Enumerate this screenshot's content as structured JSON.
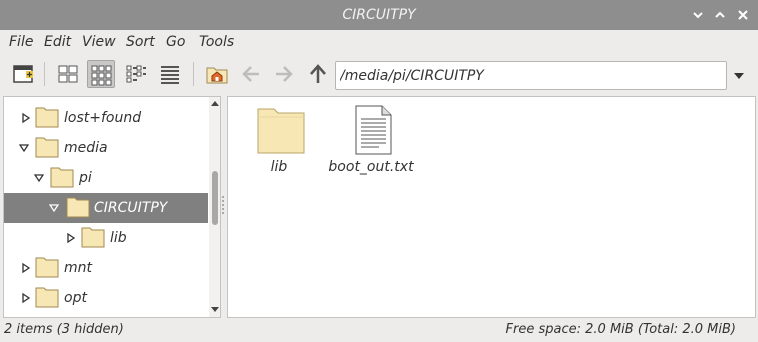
{
  "window": {
    "title": "CIRCUITPY"
  },
  "menubar": {
    "items": [
      "File",
      "Edit",
      "View",
      "Sort",
      "Go",
      "Tools"
    ]
  },
  "toolbar": {
    "path_value": "/media/pi/CIRCUITPY",
    "active_view": "icon-view"
  },
  "tree": {
    "items": [
      {
        "label": "lost+found",
        "expanded": false,
        "depth": 0
      },
      {
        "label": "media",
        "expanded": true,
        "depth": 0
      },
      {
        "label": "pi",
        "expanded": true,
        "depth": 1
      },
      {
        "label": "CIRCUITPY",
        "expanded": true,
        "depth": 2,
        "selected": true
      },
      {
        "label": "lib",
        "expanded": false,
        "depth": 3
      },
      {
        "label": "mnt",
        "expanded": false,
        "depth": 0
      },
      {
        "label": "opt",
        "expanded": false,
        "depth": 0
      }
    ]
  },
  "files": {
    "items": [
      {
        "name": "lib",
        "icon": "folder-icon"
      },
      {
        "name": "boot_out.txt",
        "icon": "text-file-icon"
      }
    ]
  },
  "status": {
    "left": "2 items (3 hidden)",
    "right": "Free space: 2.0 MiB (Total: 2.0 MiB)"
  },
  "colors": {
    "titlebar": "#8e8e8e",
    "selection": "#808080",
    "folder": "#f7e7b4"
  }
}
